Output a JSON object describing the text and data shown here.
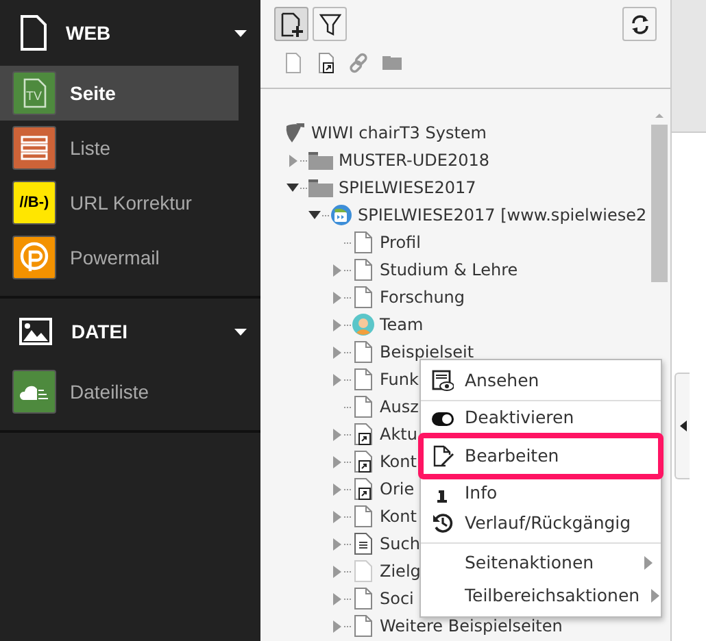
{
  "sidebar": {
    "groups": [
      {
        "title": "WEB",
        "expanded": true,
        "items": [
          {
            "label": "Seite",
            "icon_text": "TV",
            "color": "#4e8a3e",
            "selected": true
          },
          {
            "label": "Liste",
            "color": "#cd6338",
            "selected": false
          },
          {
            "label": "URL Korrektur",
            "icon_text": "//B-)",
            "color": "#ffe600",
            "selected": false
          },
          {
            "label": "Powermail",
            "color": "#f39200",
            "selected": false
          }
        ]
      },
      {
        "title": "DATEI",
        "expanded": true,
        "items": [
          {
            "label": "Dateiliste",
            "color": "#4e8a3e",
            "selected": false
          }
        ]
      }
    ]
  },
  "toolbar": {
    "buttons": [
      {
        "selected": true
      },
      {
        "selected": false
      }
    ]
  },
  "tree": {
    "root": {
      "label": "WIWI chairT3 System",
      "children": [
        {
          "label": "MUSTER-UDE2018",
          "kind": "folder",
          "expanded": false
        },
        {
          "label": "SPIELWIESE2017",
          "kind": "folder",
          "expanded": true,
          "children": [
            {
              "label": "SPIELWIESE2017 [www.spielwiese2",
              "kind": "site",
              "expanded": true,
              "children": [
                {
                  "label": "Profil",
                  "kind": "page"
                },
                {
                  "label": "Studium & Lehre",
                  "kind": "page",
                  "expanded": false
                },
                {
                  "label": "Forschung",
                  "kind": "page",
                  "expanded": false
                },
                {
                  "label": "Team",
                  "kind": "team",
                  "expanded": false
                },
                {
                  "label": "Beispielseit",
                  "kind": "page",
                  "expanded": false
                },
                {
                  "label": "Funk",
                  "kind": "page",
                  "expanded": false
                },
                {
                  "label": "Ausz",
                  "kind": "page"
                },
                {
                  "label": "Aktu",
                  "kind": "shortcut",
                  "expanded": false
                },
                {
                  "label": "Kont",
                  "kind": "shortcut",
                  "expanded": false
                },
                {
                  "label": "Orie",
                  "kind": "shortcut",
                  "expanded": false
                },
                {
                  "label": "Kont",
                  "kind": "page",
                  "expanded": false
                },
                {
                  "label": "Such",
                  "kind": "content",
                  "expanded": false
                },
                {
                  "label": "Zielg",
                  "kind": "hidden",
                  "expanded": false
                },
                {
                  "label": "Soci",
                  "kind": "page",
                  "expanded": false
                },
                {
                  "label": "Weitere Beispielseiten",
                  "kind": "page",
                  "expanded": false
                }
              ]
            }
          ]
        }
      ]
    }
  },
  "context_menu": {
    "groups": [
      [
        {
          "label": "Ansehen",
          "kind": "action",
          "highlighted": false
        }
      ],
      [
        {
          "label": "Deaktivieren",
          "kind": "action",
          "highlighted": false
        },
        {
          "label": "Bearbeiten",
          "kind": "action",
          "highlighted": true
        },
        {
          "label": "Info",
          "kind": "action",
          "highlighted": false
        },
        {
          "label": "Verlauf/Rückgängig",
          "kind": "action",
          "highlighted": false
        }
      ],
      [
        {
          "label": "Seitenaktionen",
          "kind": "submenu",
          "highlighted": false
        },
        {
          "label": "Teilbereichsaktionen",
          "kind": "submenu",
          "highlighted": false
        }
      ]
    ]
  }
}
